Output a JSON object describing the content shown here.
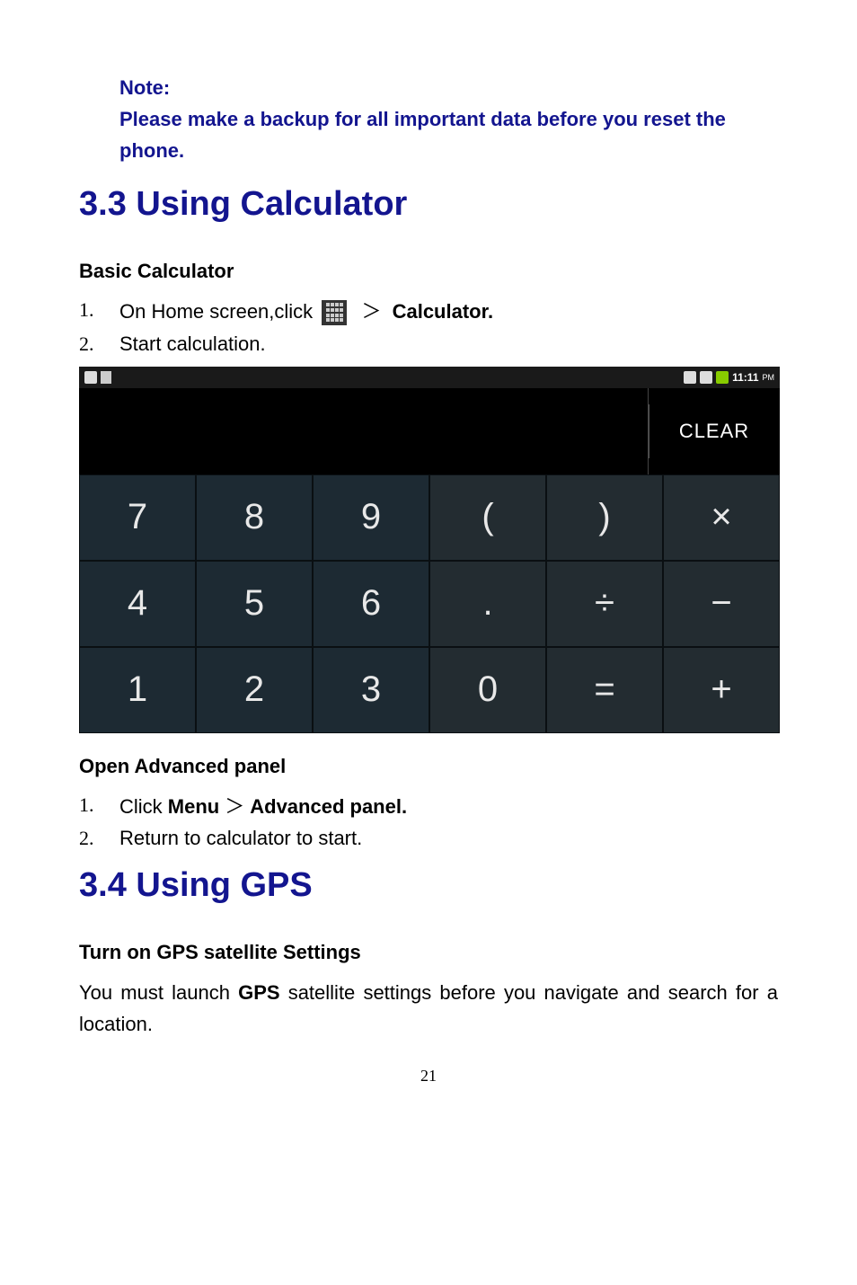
{
  "note": {
    "title": "Note:",
    "body": "Please make a backup for all important data before you reset the phone."
  },
  "section33": {
    "heading": "3.3 Using Calculator",
    "sub1": "Basic Calculator",
    "step1_num": "1.",
    "step1_a": "On Home screen,click",
    "step1_chev": "＞",
    "step1_b": "Calculator.",
    "step2_num": "2.",
    "step2": "Start calculation.",
    "sub2": "Open Advanced panel",
    "adv1_num": "1.",
    "adv1_a": "Click ",
    "adv1_b": "Menu",
    "adv1_chev": "＞",
    "adv1_c": "Advanced panel.",
    "adv2_num": "2.",
    "adv2": "Return to calculator to start."
  },
  "calc": {
    "status_time": "11:11",
    "status_ampm": "PM",
    "clear": "CLEAR",
    "keys": [
      "7",
      "8",
      "9",
      "(",
      ")",
      "×",
      "4",
      "5",
      "6",
      ".",
      "÷",
      "−",
      "1",
      "2",
      "3",
      "0",
      "=",
      "+"
    ]
  },
  "section34": {
    "heading": "3.4 Using GPS",
    "sub": "Turn on GPS satellite Settings",
    "body_a": "You must launch ",
    "body_b": "GPS",
    "body_c": " satellite settings before you navigate and search for a location."
  },
  "page_number": "21"
}
